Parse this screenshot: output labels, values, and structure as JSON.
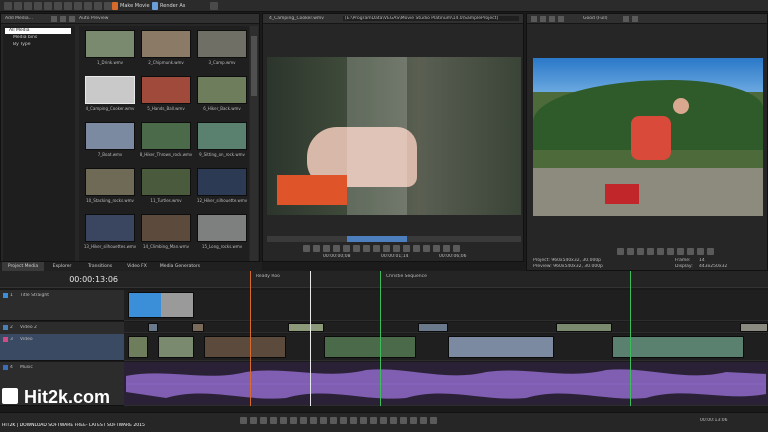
{
  "toolbar": {
    "make_movie": "Make Movie",
    "render_as": "Render As",
    "project_media_label": "Add Media...",
    "auto_preview": "Auto Preview"
  },
  "project_media": {
    "tree": [
      "All Media",
      "Media bins",
      "By Type"
    ],
    "thumbnails": [
      {
        "label": "1_Drink.wmv",
        "color": "#7a8a6e"
      },
      {
        "label": "2_Chipmunk.wmv",
        "color": "#8a7a66"
      },
      {
        "label": "3_Camp.wmv",
        "color": "#6f6f66"
      },
      {
        "label": "4_Camping_Cooker.wmv",
        "color": "#c9c9c9"
      },
      {
        "label": "5_Hands_Ball.wmv",
        "color": "#a04a3c"
      },
      {
        "label": "6_Hiker_Back.wmv",
        "color": "#6e7d5c"
      },
      {
        "label": "7_Boat.wmv",
        "color": "#7b8aa0"
      },
      {
        "label": "8_Hiker_Throws_rock.wmv",
        "color": "#4b6a4a"
      },
      {
        "label": "9_Sitting_on_rock.wmv",
        "color": "#5a8070"
      },
      {
        "label": "10_Stacking_rocks.wmv",
        "color": "#6e6a55"
      },
      {
        "label": "11_Turtles.wmv",
        "color": "#4a5a3c"
      },
      {
        "label": "12_Hiker_silhouette.wmv",
        "color": "#2c3a54"
      },
      {
        "label": "13_Hiker_silhouettes.wmv",
        "color": "#3a4660"
      },
      {
        "label": "14_Climbing_Man.wmv",
        "color": "#5c4a3c"
      },
      {
        "label": "15_Long_rocks.wmv",
        "color": "#7e8080"
      }
    ]
  },
  "trimmer": {
    "title": "4_Camping_Cooker.wmv",
    "path": "[E:\\ProgramData\\VEGAS\\Movie Studio Platinum\\14.0\\SampleProject]",
    "time_start": "00:00:00;08",
    "time_mid": "00:00:01;14",
    "time_end": "00:00:06;06"
  },
  "preview": {
    "quality": "Good (Full)",
    "project_info": "Project: 960x540x32, 30.000p",
    "preview_info": "Preview: 960x540x32, 30.000p",
    "frame_label": "Frame:",
    "frame_value": "14",
    "display_label": "Display:",
    "display_value": "443x250x32"
  },
  "tabs": [
    "Project Media",
    "Explorer",
    "Transitions",
    "Video FX",
    "Media Generators"
  ],
  "timeline": {
    "timecode": "00:00:13:06",
    "markers": [
      "Ready Roo",
      "Christie Sequence"
    ],
    "tracks": [
      {
        "name": "Title Straight",
        "num": "1",
        "color": "#3b8ed8"
      },
      {
        "name": "Video 2",
        "num": "2",
        "color": "#4a7fb8"
      },
      {
        "name": "Video",
        "num": "3",
        "color": "#d24b86"
      },
      {
        "name": "Music",
        "num": "4",
        "color": "#3d6db8"
      }
    ],
    "end_time": "00:00:13:06"
  },
  "watermark": {
    "logo": "Hit2k.com",
    "tagline": "HIT2K | DOWNLOAD SOFTWARE FREE- LATEST SOFTWARE 2015"
  }
}
